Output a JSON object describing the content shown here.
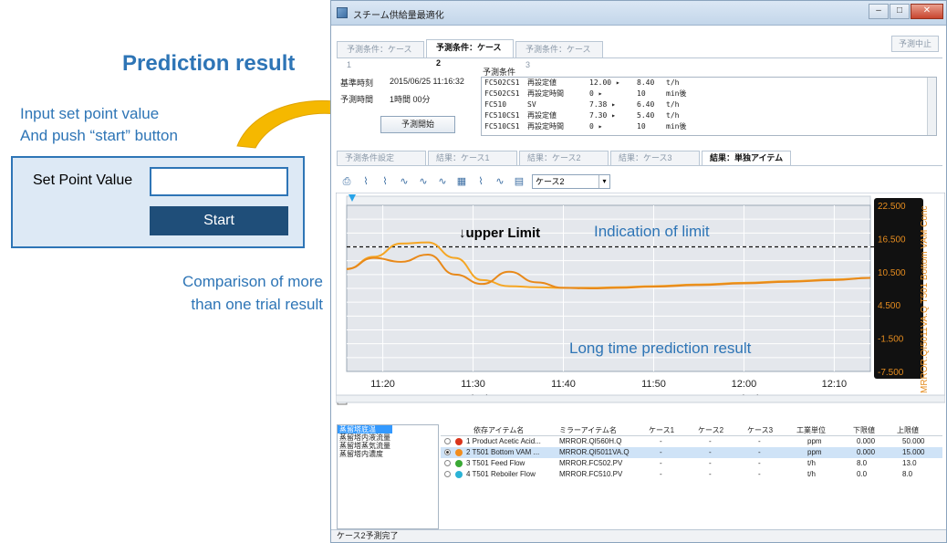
{
  "annotation": {
    "title": "Prediction result",
    "instruction_line1": "Input set point value",
    "instruction_line2": "And push “start” button",
    "setpoint_label": "Set Point Value",
    "setpoint_value": "",
    "start_label": "Start",
    "compare_line1": "Comparison of more",
    "compare_line2": "than one trial result",
    "upper_limit": "↓upper Limit",
    "indication": "Indication of limit",
    "long_time": "Long time prediction result",
    "colors": {
      "accent": "#2e75b6",
      "arrow": "#f5b800",
      "box_fill": "#dde9f5",
      "start_fill": "#1f4e79"
    }
  },
  "window": {
    "title": "スチーム供給量最適化",
    "buttons": {
      "minimize": "–",
      "maximize": "□",
      "close": "✕"
    },
    "condition_tabs": [
      "予測条件：ケース1",
      "予測条件：ケース2",
      "予測条件：ケース3"
    ],
    "stop_button": "予測中止",
    "base_time_label": "基準時刻",
    "base_time_value": "2015/06/25 11:16:32",
    "duration_label": "予測時間",
    "duration_value": "1時間 00分",
    "predict_start_button": "予測開始",
    "conditions_header": "予測条件",
    "conditions": [
      {
        "tag": "FC502CS1",
        "param": "再設定値",
        "from": "12.00 ▸",
        "to": "8.40",
        "unit": "t/h"
      },
      {
        "tag": "FC502CS1",
        "param": "再設定時間",
        "from": "0 ▸",
        "to": "10",
        "unit": "min後"
      },
      {
        "tag": "FC510",
        "param": "SV",
        "from": "7.38 ▸",
        "to": "6.40",
        "unit": "t/h"
      },
      {
        "tag": "FC510CS1",
        "param": "再設定値",
        "from": "7.30 ▸",
        "to": "5.40",
        "unit": "t/h"
      },
      {
        "tag": "FC510CS1",
        "param": "再設定時間",
        "from": "0 ▸",
        "to": "10",
        "unit": "min後"
      }
    ],
    "result_tabs": [
      "予測条件設定",
      "結果：ケース1",
      "結果：ケース2",
      "結果：ケース3",
      "結果：単独アイテム"
    ],
    "case_select": "ケース2",
    "status": "ケース2予測完了",
    "side_list": [
      "蒸留塔底温",
      "蒸留塔内液流量",
      "蒸留塔蒸気流量",
      "蒸留塔内濃度"
    ]
  },
  "grid": {
    "headers": [
      "依存アイテム名",
      "ミラーアイテム名",
      "ケース1",
      "ケース2",
      "ケース3",
      "工業単位",
      "下限値",
      "上限値"
    ],
    "rows": [
      {
        "name": "1 Product Acetic Acid...",
        "mirror": "MRROR.QI560H.Q",
        "c1": "-",
        "c2": "-",
        "c3": "-",
        "unit": "ppm",
        "lo": "0.000",
        "hi": "50.000",
        "color": "#d9351c",
        "selected": false
      },
      {
        "name": "2 T501 Bottom VAM ...",
        "mirror": "MRROR.QI5011VA.Q",
        "c1": "-",
        "c2": "-",
        "c3": "-",
        "unit": "ppm",
        "lo": "0.000",
        "hi": "15.000",
        "color": "#f28c1c",
        "selected": true
      },
      {
        "name": "3 T501 Feed Flow",
        "mirror": "MRROR.FC502.PV",
        "c1": "-",
        "c2": "-",
        "c3": "-",
        "unit": "t/h",
        "lo": "8.0",
        "hi": "13.0",
        "color": "#3aa935",
        "selected": false
      },
      {
        "name": "4 T501 Reboiler Flow",
        "mirror": "MRROR.FC510.PV",
        "c1": "-",
        "c2": "-",
        "c3": "-",
        "unit": "t/h",
        "lo": "0.0",
        "hi": "8.0",
        "color": "#2bb3d6",
        "selected": false
      }
    ]
  },
  "chart_data": {
    "type": "line",
    "x_ticks": [
      "11:20",
      "11:30",
      "11:40",
      "11:50",
      "12:00",
      "12:10"
    ],
    "date_labels": [
      "2015/06/25",
      "2015/06/25"
    ],
    "y_ticks": [
      "22.500",
      "16.500",
      "10.500",
      "4.500",
      "-1.500",
      "-7.500"
    ],
    "ylim": [
      -7.5,
      22.5
    ],
    "ylabel": "MRROR.QI5011VA.Q T501 Bottom VAM Conc",
    "upper_limit_value": 15.0,
    "grid": true,
    "series": [
      {
        "color": "#f5a623",
        "x": [
          "11:16",
          "11:19",
          "11:22",
          "11:25",
          "11:28",
          "11:31",
          "11:34",
          "11:37",
          "11:40",
          "11:43",
          "11:46",
          "11:50",
          "11:55",
          "12:00",
          "12:05",
          "12:10",
          "12:14"
        ],
        "values": [
          11.0,
          13.2,
          15.6,
          15.8,
          13.0,
          9.0,
          7.9,
          7.7,
          7.6,
          7.6,
          7.7,
          7.9,
          8.2,
          8.5,
          8.8,
          9.1,
          9.4
        ]
      },
      {
        "color": "#e8891a",
        "x": [
          "11:16",
          "11:19",
          "11:22",
          "11:25",
          "11:28",
          "11:31",
          "11:34",
          "11:37",
          "11:40",
          "11:43",
          "11:46",
          "11:50",
          "11:55",
          "12:00",
          "12:05",
          "12:10",
          "12:14"
        ],
        "values": [
          11.0,
          13.0,
          12.3,
          13.6,
          10.0,
          8.3,
          10.5,
          8.6,
          7.6,
          7.5,
          7.6,
          7.8,
          8.1,
          8.4,
          8.7,
          9.0,
          9.4
        ]
      }
    ]
  }
}
